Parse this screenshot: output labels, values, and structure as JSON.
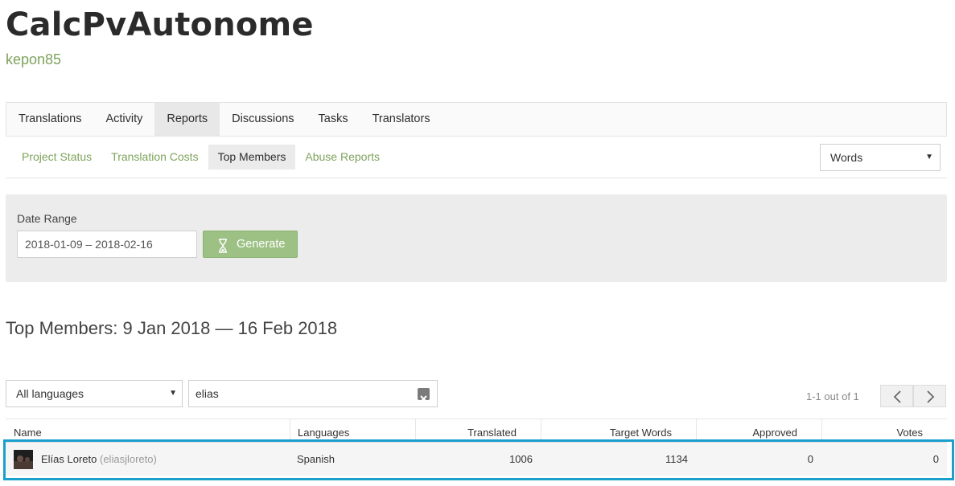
{
  "project": {
    "title": "CalcPvAutonome",
    "owner": "kepon85"
  },
  "main_tabs": [
    {
      "label": "Translations"
    },
    {
      "label": "Activity"
    },
    {
      "label": "Reports"
    },
    {
      "label": "Discussions"
    },
    {
      "label": "Tasks"
    },
    {
      "label": "Translators"
    }
  ],
  "sub_tabs": [
    {
      "label": "Project Status"
    },
    {
      "label": "Translation Costs"
    },
    {
      "label": "Top Members"
    },
    {
      "label": "Abuse Reports"
    }
  ],
  "unit_select": {
    "value": "Words"
  },
  "filter": {
    "date_range_label": "Date Range",
    "date_range_value": "2018-01-09 – 2018-02-16",
    "generate_label": "Generate"
  },
  "section_title": "Top Members: 9 Jan 2018 — 16 Feb 2018",
  "table_controls": {
    "language_select": "All languages",
    "search_value": "elias",
    "pager_text": "1-1 out of 1"
  },
  "table": {
    "columns": [
      "Name",
      "Languages",
      "Translated",
      "Target Words",
      "Approved",
      "Votes"
    ],
    "rows": [
      {
        "name": "Elías Loreto",
        "username": "(eliasjloreto)",
        "language": "Spanish",
        "translated": "1006",
        "target_words": "1134",
        "approved": "0",
        "votes": "0"
      }
    ]
  },
  "colors": {
    "accent_green": "#7da35b",
    "generate_button": "#9dc184",
    "highlight_blue": "#1b9fcc"
  }
}
